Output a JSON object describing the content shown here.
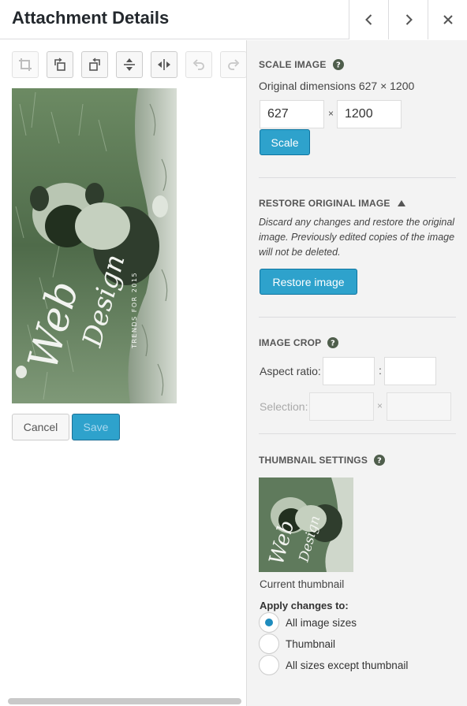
{
  "header": {
    "title": "Attachment Details",
    "prev_icon": "chevron-left-icon",
    "next_icon": "chevron-right-icon",
    "close_icon": "close-icon"
  },
  "toolbar": {
    "tools": [
      {
        "icon": "crop-icon",
        "enabled": false
      },
      {
        "icon": "rotate-left-icon",
        "enabled": true
      },
      {
        "icon": "rotate-right-icon",
        "enabled": true
      },
      {
        "icon": "flip-vertical-icon",
        "enabled": true
      },
      {
        "icon": "flip-horizontal-icon",
        "enabled": true
      },
      {
        "icon": "undo-icon",
        "enabled": false
      },
      {
        "icon": "redo-icon",
        "enabled": false
      }
    ]
  },
  "image": {
    "script_text": "Web",
    "script_text2": "Design",
    "vertical_text": "TRENDS FOR 2015"
  },
  "actions": {
    "cancel_label": "Cancel",
    "save_label": "Save"
  },
  "scale": {
    "title": "Scale Image",
    "original_dimensions": "Original dimensions 627 × 1200",
    "width_value": "627",
    "height_value": "1200",
    "times": "×",
    "button_label": "Scale"
  },
  "restore": {
    "title": "Restore Original Image",
    "description": "Discard any changes and restore the original image. Previously edited copies of the image will not be deleted.",
    "button_label": "Restore image"
  },
  "crop": {
    "title": "Image Crop",
    "aspect_label": "Aspect ratio:",
    "colon": ":",
    "selection_label": "Selection:",
    "times": "×"
  },
  "thumbnail": {
    "title": "Thumbnail Settings",
    "current_label": "Current thumbnail",
    "apply_label": "Apply changes to:",
    "options": [
      {
        "label": "All image sizes",
        "selected": true
      },
      {
        "label": "Thumbnail",
        "selected": false
      },
      {
        "label": "All sizes except thumbnail",
        "selected": false
      }
    ]
  },
  "colors": {
    "accent": "#2ea2cc",
    "photo_tint": "#5f7a5c"
  }
}
